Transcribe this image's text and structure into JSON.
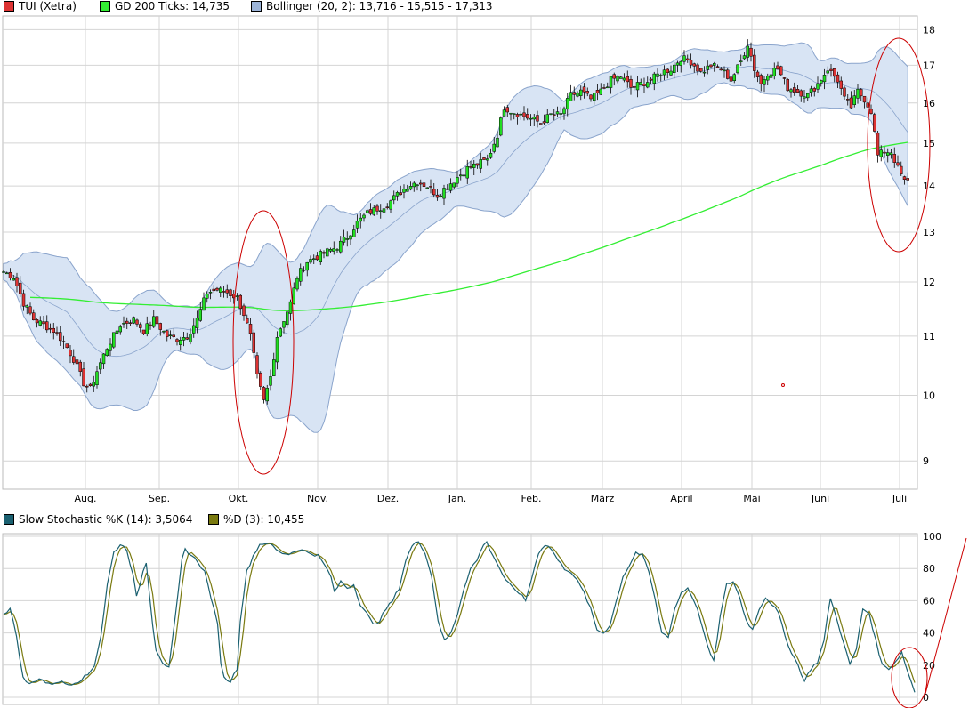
{
  "colors": {
    "up": "#22dd22",
    "down": "#dd3333",
    "sma": "#33ee33",
    "band_fill": "#d8e4f4",
    "band_line": "#8aa4cc",
    "grid": "#d4d4d4",
    "stoch_k": "#1a6070",
    "stoch_d": "#7a7a10",
    "annotation": "#cc0000"
  },
  "legend_top": [
    {
      "label": "TUI (Xetra)",
      "color": "#dd3333"
    },
    {
      "label": "GD 200 Ticks: 14,735",
      "color": "#33ee33"
    },
    {
      "label": "Bollinger (20, 2): 13,716 - 15,515 - 17,313",
      "color": "#9db5d9"
    }
  ],
  "legend_bottom": [
    {
      "label": "Slow Stochastic %K (14): 3,5064",
      "color": "#1a6070"
    },
    {
      "label": "%D (3): 10,455",
      "color": "#7a7a10"
    }
  ],
  "chart_data": [
    {
      "type": "candlestick",
      "title": "TUI (Xetra)",
      "x_ticks": [
        "Aug.",
        "Sep.",
        "Okt.",
        "Nov.",
        "Dez.",
        "Jan.",
        "Feb.",
        "März",
        "April",
        "Mai",
        "Juni",
        "Juli"
      ],
      "y_ticks": [
        9,
        10,
        11,
        12,
        13,
        14,
        15,
        16,
        17,
        18
      ],
      "ylim": [
        8.6,
        18.4
      ],
      "y_scale": "log",
      "grid": true,
      "close_anchors": [
        [
          0,
          12.2
        ],
        [
          3,
          12.1
        ],
        [
          6,
          11.6
        ],
        [
          9,
          11.3
        ],
        [
          12,
          11.2
        ],
        [
          15,
          11.1
        ],
        [
          18,
          10.9
        ],
        [
          21,
          10.6
        ],
        [
          24,
          10.2
        ],
        [
          26,
          10.1
        ],
        [
          28,
          10.4
        ],
        [
          31,
          10.8
        ],
        [
          35,
          11.2
        ],
        [
          39,
          11.3
        ],
        [
          42,
          11.1
        ],
        [
          45,
          11.3
        ],
        [
          49,
          11.0
        ],
        [
          52,
          10.95
        ],
        [
          55,
          11.0
        ],
        [
          58,
          11.3
        ],
        [
          61,
          11.8
        ],
        [
          64,
          11.85
        ],
        [
          67,
          11.8
        ],
        [
          70,
          11.7
        ],
        [
          72,
          11.4
        ],
        [
          74,
          11.0
        ],
        [
          76,
          10.3
        ],
        [
          78,
          9.9
        ],
        [
          80,
          10.3
        ],
        [
          82,
          11.0
        ],
        [
          84,
          11.3
        ],
        [
          86,
          11.6
        ],
        [
          88,
          12.1
        ],
        [
          91,
          12.4
        ],
        [
          94,
          12.5
        ],
        [
          97,
          12.6
        ],
        [
          100,
          12.7
        ],
        [
          103,
          12.9
        ],
        [
          106,
          13.2
        ],
        [
          109,
          13.4
        ],
        [
          112,
          13.5
        ],
        [
          115,
          13.6
        ],
        [
          118,
          13.8
        ],
        [
          121,
          14.0
        ],
        [
          124,
          14.1
        ],
        [
          127,
          14.0
        ],
        [
          130,
          13.8
        ],
        [
          133,
          14.0
        ],
        [
          136,
          14.2
        ],
        [
          139,
          14.4
        ],
        [
          142,
          14.5
        ],
        [
          145,
          14.6
        ],
        [
          148,
          15.2
        ],
        [
          150,
          15.9
        ],
        [
          152,
          15.8
        ],
        [
          155,
          15.7
        ],
        [
          158,
          15.6
        ],
        [
          161,
          15.5
        ],
        [
          164,
          15.7
        ],
        [
          167,
          15.7
        ],
        [
          170,
          16.2
        ],
        [
          173,
          16.3
        ],
        [
          176,
          16.1
        ],
        [
          179,
          16.3
        ],
        [
          182,
          16.6
        ],
        [
          185,
          16.7
        ],
        [
          188,
          16.4
        ],
        [
          191,
          16.5
        ],
        [
          194,
          16.6
        ],
        [
          197,
          16.8
        ],
        [
          200,
          16.9
        ],
        [
          203,
          17.2
        ],
        [
          206,
          17.1
        ],
        [
          209,
          16.8
        ],
        [
          212,
          17.0
        ],
        [
          215,
          16.9
        ],
        [
          218,
          16.6
        ],
        [
          221,
          17.1
        ],
        [
          223,
          17.6
        ],
        [
          225,
          16.9
        ],
        [
          227,
          16.5
        ],
        [
          229,
          16.8
        ],
        [
          232,
          16.9
        ],
        [
          235,
          16.4
        ],
        [
          238,
          16.3
        ],
        [
          241,
          16.2
        ],
        [
          244,
          16.5
        ],
        [
          247,
          16.9
        ],
        [
          250,
          16.6
        ],
        [
          252,
          16.1
        ],
        [
          254,
          15.9
        ],
        [
          256,
          16.3
        ],
        [
          258,
          16.1
        ],
        [
          260,
          15.8
        ],
        [
          262,
          14.7
        ],
        [
          264,
          14.8
        ],
        [
          266,
          14.8
        ],
        [
          268,
          14.4
        ],
        [
          270,
          14.1
        ]
      ],
      "sma_label": "GD 200 Ticks",
      "sma_last": 14.735,
      "bollinger_label": "Bollinger (20, 2)",
      "bollinger_last": [
        13.716,
        15.515,
        17.313
      ]
    },
    {
      "type": "line",
      "x_ticks": [
        "Aug.",
        "Sep.",
        "Okt.",
        "Nov.",
        "Dez.",
        "Jan.",
        "Feb.",
        "März",
        "April",
        "Mai",
        "Juni",
        "Juli"
      ],
      "y_ticks": [
        0,
        20,
        40,
        60,
        80,
        100
      ],
      "ylim": [
        0,
        100
      ],
      "grid": true,
      "series": [
        {
          "name": "Slow Stochastic %K (14)",
          "last": 3.5064,
          "anchors": [
            [
              0,
              52
            ],
            [
              2,
              55
            ],
            [
              4,
              38
            ],
            [
              6,
              12
            ],
            [
              8,
              8
            ],
            [
              11,
              12
            ],
            [
              14,
              8
            ],
            [
              17,
              10
            ],
            [
              20,
              8
            ],
            [
              23,
              10
            ],
            [
              26,
              14
            ],
            [
              28,
              20
            ],
            [
              30,
              38
            ],
            [
              32,
              70
            ],
            [
              34,
              90
            ],
            [
              36,
              95
            ],
            [
              38,
              92
            ],
            [
              40,
              75
            ],
            [
              41,
              62
            ],
            [
              43,
              78
            ],
            [
              44,
              84
            ],
            [
              46,
              45
            ],
            [
              47,
              30
            ],
            [
              49,
              22
            ],
            [
              51,
              18
            ],
            [
              53,
              50
            ],
            [
              55,
              85
            ],
            [
              56,
              92
            ],
            [
              58,
              88
            ],
            [
              60,
              84
            ],
            [
              62,
              78
            ],
            [
              64,
              62
            ],
            [
              66,
              45
            ],
            [
              67,
              22
            ],
            [
              68,
              12
            ],
            [
              70,
              10
            ],
            [
              72,
              18
            ],
            [
              73,
              48
            ],
            [
              75,
              78
            ],
            [
              77,
              88
            ],
            [
              79,
              95
            ],
            [
              81,
              96
            ],
            [
              83,
              94
            ],
            [
              85,
              90
            ],
            [
              88,
              89
            ],
            [
              91,
              92
            ],
            [
              94,
              90
            ],
            [
              97,
              88
            ],
            [
              99,
              82
            ],
            [
              101,
              75
            ],
            [
              102,
              65
            ],
            [
              104,
              72
            ],
            [
              106,
              68
            ],
            [
              108,
              70
            ],
            [
              110,
              58
            ],
            [
              112,
              52
            ],
            [
              114,
              45
            ],
            [
              116,
              48
            ],
            [
              118,
              55
            ],
            [
              120,
              60
            ],
            [
              122,
              68
            ],
            [
              124,
              85
            ],
            [
              126,
              94
            ],
            [
              128,
              97
            ],
            [
              130,
              90
            ],
            [
              132,
              75
            ],
            [
              134,
              48
            ],
            [
              136,
              35
            ],
            [
              138,
              40
            ],
            [
              140,
              52
            ],
            [
              142,
              68
            ],
            [
              144,
              80
            ],
            [
              146,
              85
            ],
            [
              148,
              95
            ],
            [
              149,
              96
            ],
            [
              151,
              88
            ],
            [
              153,
              80
            ],
            [
              155,
              72
            ],
            [
              157,
              68
            ],
            [
              159,
              65
            ],
            [
              161,
              60
            ],
            [
              163,
              75
            ],
            [
              165,
              90
            ],
            [
              167,
              95
            ],
            [
              169,
              92
            ],
            [
              171,
              85
            ],
            [
              173,
              80
            ],
            [
              175,
              78
            ],
            [
              177,
              72
            ],
            [
              179,
              65
            ],
            [
              181,
              55
            ],
            [
              183,
              42
            ],
            [
              185,
              40
            ],
            [
              187,
              45
            ],
            [
              189,
              60
            ],
            [
              191,
              75
            ],
            [
              193,
              82
            ],
            [
              195,
              90
            ],
            [
              197,
              88
            ],
            [
              199,
              78
            ],
            [
              201,
              60
            ],
            [
              203,
              40
            ],
            [
              205,
              38
            ],
            [
              207,
              55
            ],
            [
              209,
              65
            ],
            [
              211,
              68
            ],
            [
              213,
              60
            ],
            [
              215,
              48
            ],
            [
              217,
              32
            ],
            [
              219,
              22
            ],
            [
              221,
              50
            ],
            [
              223,
              70
            ],
            [
              225,
              72
            ],
            [
              227,
              62
            ],
            [
              229,
              48
            ],
            [
              231,
              42
            ],
            [
              233,
              55
            ],
            [
              235,
              62
            ],
            [
              237,
              58
            ],
            [
              239,
              52
            ],
            [
              241,
              38
            ],
            [
              243,
              28
            ],
            [
              245,
              20
            ],
            [
              247,
              10
            ],
            [
              249,
              18
            ],
            [
              251,
              22
            ],
            [
              253,
              35
            ],
            [
              255,
              62
            ],
            [
              257,
              48
            ],
            [
              259,
              35
            ],
            [
              261,
              20
            ],
            [
              263,
              30
            ],
            [
              265,
              55
            ],
            [
              267,
              52
            ],
            [
              269,
              35
            ],
            [
              271,
              20
            ],
            [
              273,
              18
            ],
            [
              275,
              22
            ],
            [
              277,
              28
            ],
            [
              279,
              15
            ],
            [
              281,
              3.5
            ]
          ]
        },
        {
          "name": "%D (3)",
          "last": 10.455
        }
      ]
    }
  ]
}
